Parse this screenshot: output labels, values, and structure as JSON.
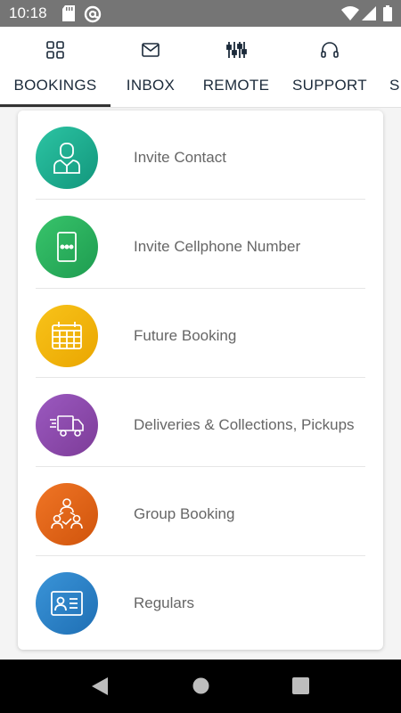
{
  "status_bar": {
    "time": "10:18",
    "icons": [
      "sd-card-icon",
      "at-sign-icon",
      "wifi-icon",
      "signal-icon",
      "battery-icon"
    ]
  },
  "tabs": [
    {
      "label": "BOOKINGS",
      "icon": "grid-icon",
      "active": true
    },
    {
      "label": "INBOX",
      "icon": "envelope-icon",
      "active": false
    },
    {
      "label": "REMOTE",
      "icon": "sliders-icon",
      "active": false
    },
    {
      "label": "SUPPORT",
      "icon": "headphones-icon",
      "active": false
    },
    {
      "label": "S",
      "icon": "",
      "active": false
    }
  ],
  "menu": {
    "items": [
      {
        "label": "Invite Contact",
        "icon": "person-icon",
        "color": "#1aaa8f"
      },
      {
        "label": "Invite Cellphone Number",
        "icon": "cellphone-icon",
        "color": "#27ae60"
      },
      {
        "label": "Future Booking",
        "icon": "calendar-icon",
        "color": "#f2b400"
      },
      {
        "label": "Deliveries & Collections, Pickups",
        "icon": "delivery-truck-icon",
        "color": "#8e44ad"
      },
      {
        "label": "Group Booking",
        "icon": "group-icon",
        "color": "#e06014"
      },
      {
        "label": "Regulars",
        "icon": "id-card-icon",
        "color": "#2b7fc6"
      }
    ]
  },
  "nav_bar": {
    "buttons": [
      "back-icon",
      "home-icon",
      "recents-icon"
    ]
  }
}
